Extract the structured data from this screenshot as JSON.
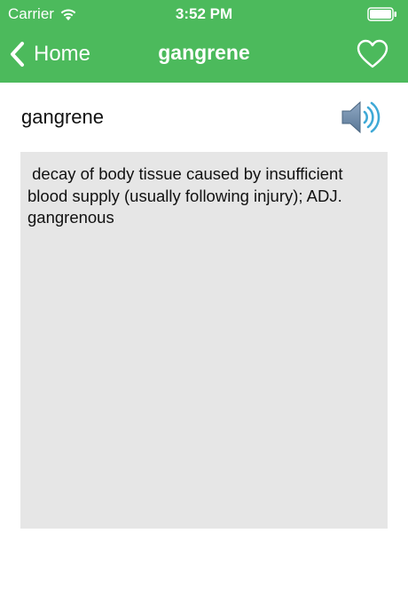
{
  "status_bar": {
    "carrier": "Carrier",
    "time": "3:52 PM",
    "wifi_icon": "wifi-icon",
    "battery_icon": "battery-icon"
  },
  "nav_bar": {
    "back_label": "Home",
    "title": "gangrene",
    "back_icon": "chevron-left-icon",
    "favorite_icon": "heart-outline-icon",
    "color": "#4cba5c"
  },
  "entry": {
    "word": "gangrene",
    "speaker_icon": "speaker-icon",
    "definition": " decay of body tissue caused by insufficient blood supply (usually following injury); ADJ. gangrenous",
    "definition_bg": "#e6e6e6"
  }
}
